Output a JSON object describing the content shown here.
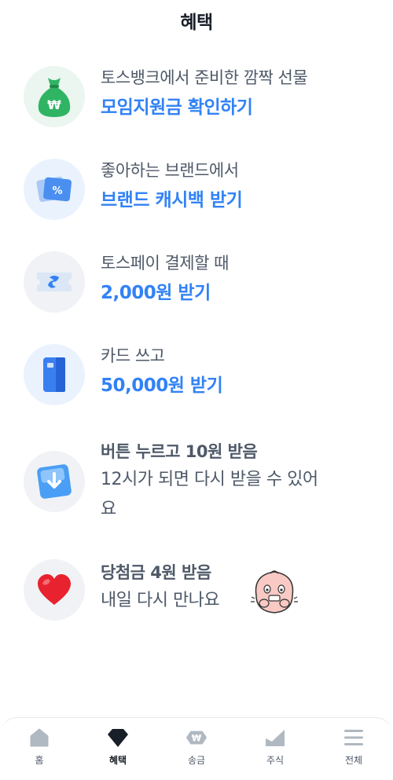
{
  "header": {
    "title": "혜택"
  },
  "benefits": [
    {
      "line1": "토스뱅크에서 준비한 깜짝 선물",
      "line2": "모임지원금 확인하기",
      "icon": "money-bag-icon"
    },
    {
      "line1": "좋아하는 브랜드에서",
      "line2": "브랜드 캐시백 받기",
      "icon": "coupon-percent-icon"
    },
    {
      "line1": "토스페이 결제할 때",
      "line2": "2,000원 받기",
      "icon": "toss-pay-ticket-icon"
    },
    {
      "line1": "카드 쓰고",
      "line2": "50,000원 받기",
      "icon": "card-icon"
    },
    {
      "line1": "버튼 누르고 10원 받음",
      "line2": "12시가 되면 다시 받을 수 있어",
      "line3": "요",
      "icon": "download-box-icon"
    },
    {
      "line1": "당첨금 4원 받음",
      "line2": "내일 다시 만나요",
      "icon": "heart-icon"
    }
  ],
  "nav": [
    {
      "label": "홈",
      "icon": "home-icon"
    },
    {
      "label": "혜택",
      "icon": "diamond-icon",
      "active": true
    },
    {
      "label": "송금",
      "icon": "won-transfer-icon"
    },
    {
      "label": "주식",
      "icon": "chart-icon"
    },
    {
      "label": "전체",
      "icon": "menu-icon"
    }
  ],
  "colors": {
    "accent": "#3182f6",
    "text_primary": "#191f28",
    "text_secondary": "#4e5968",
    "nav_icon": "#b0b8c1"
  }
}
